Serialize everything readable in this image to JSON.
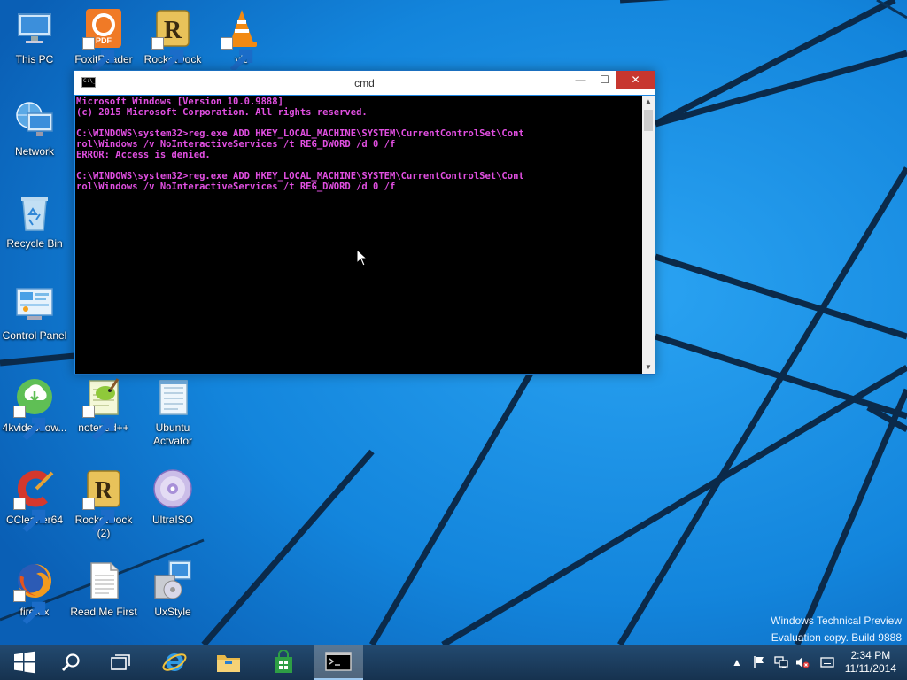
{
  "desktop": {
    "icons": [
      {
        "label": "This PC"
      },
      {
        "label": "FoxitReader"
      },
      {
        "label": "RocketDock"
      },
      {
        "label": "vlc"
      },
      {
        "label": "Network"
      },
      {
        "label": "Recycle Bin"
      },
      {
        "label": "Control Panel"
      },
      {
        "label": "4kvideodow..."
      },
      {
        "label": "notepad++"
      },
      {
        "label": "Ubuntu Actvator"
      },
      {
        "label": "CCleaner64"
      },
      {
        "label": "RocketDock (2)"
      },
      {
        "label": "UltraISO"
      },
      {
        "label": "firefox"
      },
      {
        "label": "Read Me First"
      },
      {
        "label": "UxStyle"
      }
    ]
  },
  "cmd_window": {
    "title": "cmd",
    "icon_text": "C:\\_",
    "minimize_glyph": "—",
    "maximize_glyph": "☐",
    "close_glyph": "✕",
    "lines": [
      "Microsoft Windows [Version 10.0.9888]",
      "(c) 2015 Microsoft Corporation. All rights reserved.",
      "",
      "C:\\WINDOWS\\system32>reg.exe ADD HKEY_LOCAL_MACHINE\\SYSTEM\\CurrentControlSet\\Cont",
      "rol\\Windows /v NoInteractiveServices /t REG_DWORD /d 0 /f",
      "ERROR: Access is denied.",
      "",
      "C:\\WINDOWS\\system32>reg.exe ADD HKEY_LOCAL_MACHINE\\SYSTEM\\CurrentControlSet\\Cont",
      "rol\\Windows /v NoInteractiveServices /t REG_DWORD /d 0 /f"
    ],
    "text_color": "#e14fe1"
  },
  "watermark": {
    "line1": "Windows Technical Preview",
    "line2": "Evaluation copy. Build 9888"
  },
  "taskbar": {
    "buttons": [
      "windows-logo-icon",
      "search-icon",
      "task-view-icon",
      "internet-explorer-icon",
      "file-explorer-icon",
      "store-icon",
      "cmd-icon"
    ],
    "tray": [
      "chevron-up-icon",
      "flag-icon",
      "network-icon",
      "speaker-muted-icon",
      "message-icon"
    ],
    "time": "2:34 PM",
    "date": "11/11/2014"
  },
  "colors": {
    "wallpaper": "#1581d8",
    "taskbar": "#1b3a5a",
    "close_button": "#c7362f"
  }
}
